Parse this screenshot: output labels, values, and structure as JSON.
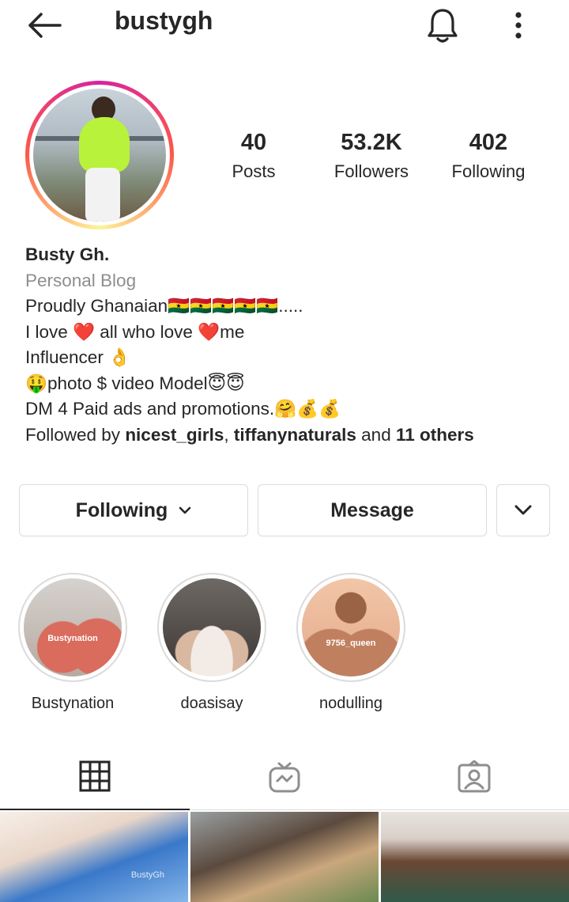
{
  "header": {
    "username": "bustygh"
  },
  "stats": {
    "posts": {
      "value": "40",
      "label": "Posts"
    },
    "followers": {
      "value": "53.2K",
      "label": "Followers"
    },
    "following": {
      "value": "402",
      "label": "Following"
    }
  },
  "bio": {
    "name": "Busty Gh.",
    "category": "Personal Blog",
    "line1": "Proudly Ghanaian🇬🇭🇬🇭🇬🇭🇬🇭🇬🇭.....",
    "line2": "I love ❤️ all who love ❤️me",
    "line3": "Influencer 👌",
    "line4": "🤑photo $ video Model😇😇",
    "line5": "DM 4 Paid ads and promotions.🤗💰💰",
    "followed_by_prefix": "Followed by ",
    "followed_by_user1": "nicest_girls",
    "followed_by_sep": ", ",
    "followed_by_user2": "tiffanynaturals",
    "followed_by_and": " and ",
    "followed_by_others": "11 others"
  },
  "actions": {
    "following_label": "Following",
    "message_label": "Message"
  },
  "highlights": [
    {
      "name": "Bustynation",
      "caption": "Bustynation"
    },
    {
      "name": "doasisay",
      "caption": ""
    },
    {
      "name": "nodulling",
      "caption": "9756_queen"
    }
  ],
  "grid": {
    "thumb1_watermark": "BustyGh"
  },
  "colors": {
    "text": "#262626",
    "secondary": "#8e8e8e",
    "border": "#dbdbdb"
  },
  "icons": {
    "back": "arrow-left-icon",
    "notifications": "bell-icon",
    "more": "more-vertical-icon",
    "grid_tab": "grid-icon",
    "igtv_tab": "igtv-icon",
    "tagged_tab": "tagged-icon"
  }
}
